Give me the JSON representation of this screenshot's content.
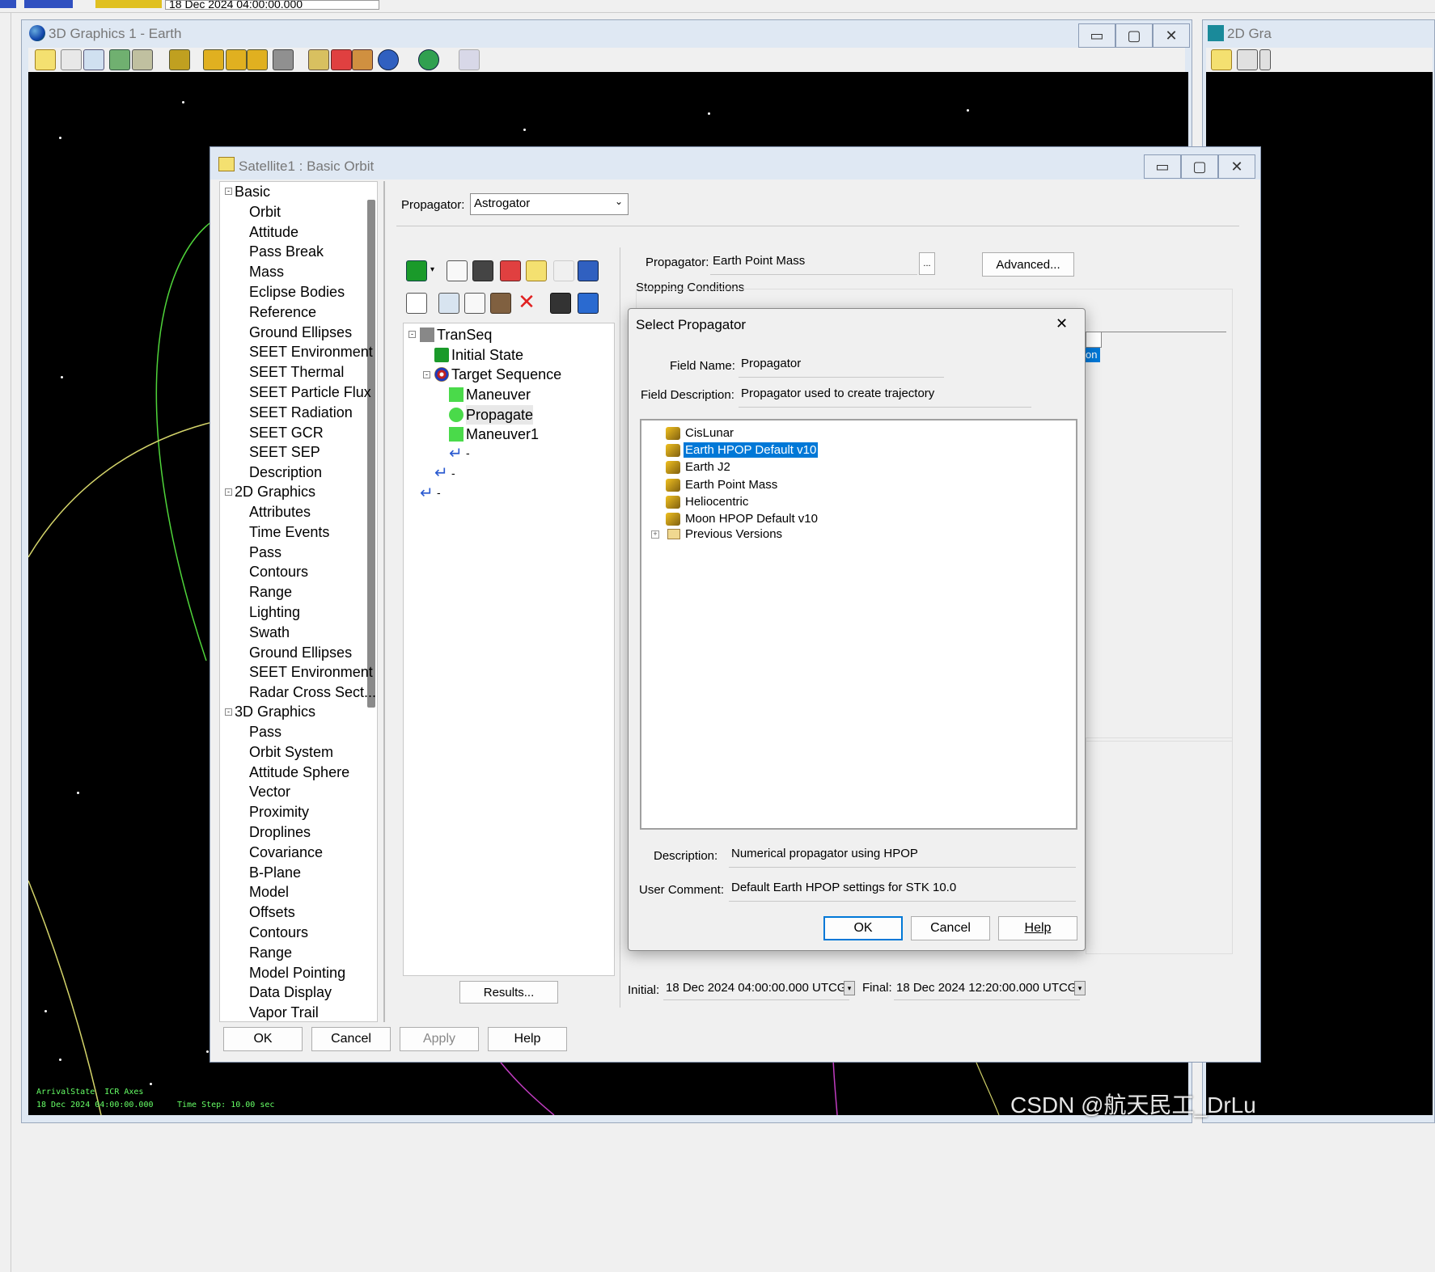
{
  "topbar": {
    "date": "18 Dec 2024 04:00:00.000"
  },
  "win3d": {
    "title": "3D Graphics 1 - Earth",
    "status": {
      "line1": "ArrivalState  ICR Axes",
      "line2": "18 Dec 2024 04:00:00.000",
      "timestep": "Time Step: 10.00 sec"
    }
  },
  "win2d": {
    "title": "2D Gra"
  },
  "props": {
    "title": "Satellite1 : Basic Orbit",
    "propagator_label": "Propagator:",
    "propagator_value": "Astrogator",
    "inner_propagator_label": "Propagator:",
    "inner_propagator_value": "Earth Point Mass",
    "ellipsis": "...",
    "advanced": "Advanced...",
    "stopping": "Stopping Conditions",
    "results": "Results...",
    "initial_label": "Initial:",
    "initial_value": "18 Dec 2024 04:00:00.000 UTCG",
    "final_label": "Final:",
    "final_value": "18 Dec 2024 12:20:00.000 UTCG",
    "cut_text": "on",
    "buttons": {
      "ok": "OK",
      "cancel": "Cancel",
      "apply": "Apply",
      "help": "Help"
    },
    "nav": {
      "basic": {
        "label": "Basic",
        "items": [
          "Orbit",
          "Attitude",
          "Pass Break",
          "Mass",
          "Eclipse Bodies",
          "Reference",
          "Ground Ellipses",
          "SEET Environment",
          "SEET Thermal",
          "SEET Particle Flux",
          "SEET Radiation",
          "SEET GCR",
          "SEET SEP",
          "Description"
        ]
      },
      "g2d": {
        "label": "2D Graphics",
        "items": [
          "Attributes",
          "Time Events",
          "Pass",
          "Contours",
          "Range",
          "Lighting",
          "Swath",
          "Ground Ellipses",
          "SEET Environment",
          "Radar Cross Sect..."
        ]
      },
      "g3d": {
        "label": "3D Graphics",
        "items": [
          "Pass",
          "Orbit System",
          "Attitude Sphere",
          "Vector",
          "Proximity",
          "Droplines",
          "Covariance",
          "B-Plane",
          "Model",
          "Offsets",
          "Contours",
          "Range",
          "Model Pointing",
          "Data Display",
          "Vapor Trail"
        ]
      }
    },
    "mcs": {
      "transeq": "TranSeq",
      "initial_state": "Initial State",
      "target_sequence": "Target Sequence",
      "maneuver": "Maneuver",
      "propagate": "Propagate",
      "maneuver1": "Maneuver1",
      "dash": "-"
    }
  },
  "dialog": {
    "title": "Select Propagator",
    "close": "✕",
    "field_name_label": "Field Name:",
    "field_name_value": "Propagator",
    "field_desc_label": "Field Description:",
    "field_desc_value": "Propagator used to create trajectory",
    "list": [
      "CisLunar",
      "Earth HPOP Default v10",
      "Earth J2",
      "Earth Point Mass",
      "Heliocentric",
      "Moon HPOP Default v10"
    ],
    "folder": "Previous Versions",
    "description_label": "Description:",
    "description_value": "Numerical propagator using HPOP",
    "comment_label": "User Comment:",
    "comment_value": "Default Earth HPOP settings for STK 10.0",
    "ok": "OK",
    "cancel": "Cancel",
    "help": "Help"
  },
  "watermark": "CSDN @航天民工_DrLu",
  "colors": {
    "selection": "#0078d7",
    "space": "#000000",
    "orbit_green": "#4fd43a",
    "orbit_yellow": "#d4d46a",
    "orbit_magenta": "#c03cc0"
  }
}
